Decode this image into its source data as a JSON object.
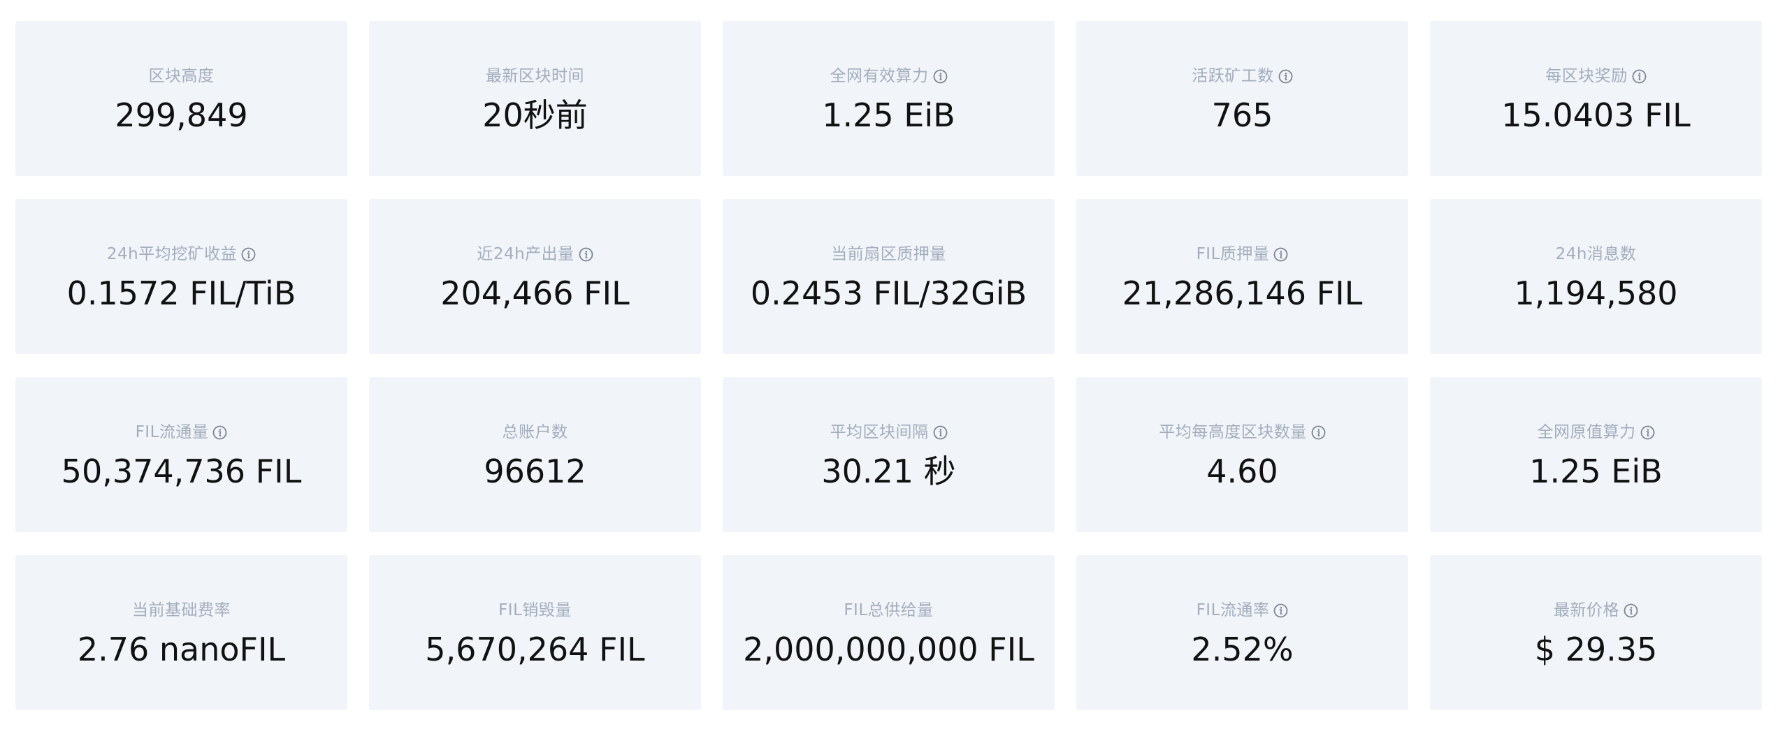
{
  "stats": [
    {
      "label": "区块高度",
      "value": "299,849",
      "info": false
    },
    {
      "label": "最新区块时间",
      "value": "20秒前",
      "info": false
    },
    {
      "label": "全网有效算力",
      "value": "1.25 EiB",
      "info": true
    },
    {
      "label": "活跃矿工数",
      "value": "765",
      "info": true
    },
    {
      "label": "每区块奖励",
      "value": "15.0403 FIL",
      "info": true
    },
    {
      "label": "24h平均挖矿收益",
      "value": "0.1572 FIL/TiB",
      "info": true
    },
    {
      "label": "近24h产出量",
      "value": "204,466 FIL",
      "info": true
    },
    {
      "label": "当前扇区质押量",
      "value": "0.2453 FIL/32GiB",
      "info": false
    },
    {
      "label": "FIL质押量",
      "value": "21,286,146 FIL",
      "info": true
    },
    {
      "label": "24h消息数",
      "value": "1,194,580",
      "info": false
    },
    {
      "label": "FIL流通量",
      "value": "50,374,736 FIL",
      "info": true
    },
    {
      "label": "总账户数",
      "value": "96612",
      "info": false
    },
    {
      "label": "平均区块间隔",
      "value": "30.21 秒",
      "info": true
    },
    {
      "label": "平均每高度区块数量",
      "value": "4.60",
      "info": true
    },
    {
      "label": "全网原值算力",
      "value": "1.25 EiB",
      "info": true
    },
    {
      "label": "当前基础费率",
      "value": "2.76 nanoFIL",
      "info": false
    },
    {
      "label": "FIL销毁量",
      "value": "5,670,264 FIL",
      "info": false
    },
    {
      "label": "FIL总供给量",
      "value": "2,000,000,000 FIL",
      "info": false
    },
    {
      "label": "FIL流通率",
      "value": "2.52%",
      "info": true
    },
    {
      "label": "最新价格",
      "value": "$ 29.35",
      "info": true
    }
  ],
  "icons": {
    "info": "info-circle-icon"
  },
  "colors": {
    "card_background": "#f1f5f9",
    "label": "#a3adbd",
    "value": "#111111"
  }
}
